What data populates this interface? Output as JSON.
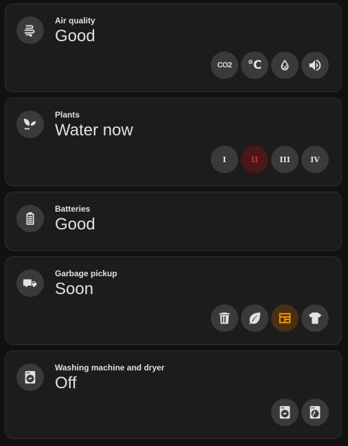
{
  "cards": [
    {
      "name": "Air quality",
      "state": "Good",
      "icon": "air-filter-icon",
      "chips": [
        {
          "icon": "co2-icon",
          "label": "CO2"
        },
        {
          "icon": "celsius-icon",
          "label": "℃"
        },
        {
          "icon": "humidity-icon"
        },
        {
          "icon": "volume-icon"
        }
      ]
    },
    {
      "name": "Plants",
      "state": "Water now",
      "icon": "sprout-icon",
      "chips": [
        {
          "icon": "roman-one-icon",
          "label": "I"
        },
        {
          "icon": "roman-two-icon",
          "label": "II",
          "color": "#e8282a"
        },
        {
          "icon": "roman-three-icon",
          "label": "III"
        },
        {
          "icon": "roman-four-icon",
          "label": "IV"
        }
      ]
    },
    {
      "name": "Batteries",
      "state": "Good",
      "icon": "battery-icon",
      "chips": []
    },
    {
      "name": "Garbage pickup",
      "state": "Soon",
      "icon": "garbage-truck-icon",
      "chips": [
        {
          "icon": "trash-can-icon"
        },
        {
          "icon": "leaf-icon"
        },
        {
          "icon": "newspaper-icon",
          "color": "#ff9800"
        },
        {
          "icon": "tshirt-icon"
        }
      ]
    },
    {
      "name": "Washing machine and dryer",
      "state": "Off",
      "icon": "washing-machine-icon",
      "chips": [
        {
          "icon": "washing-machine-icon"
        },
        {
          "icon": "tumble-dryer-icon"
        }
      ]
    }
  ]
}
